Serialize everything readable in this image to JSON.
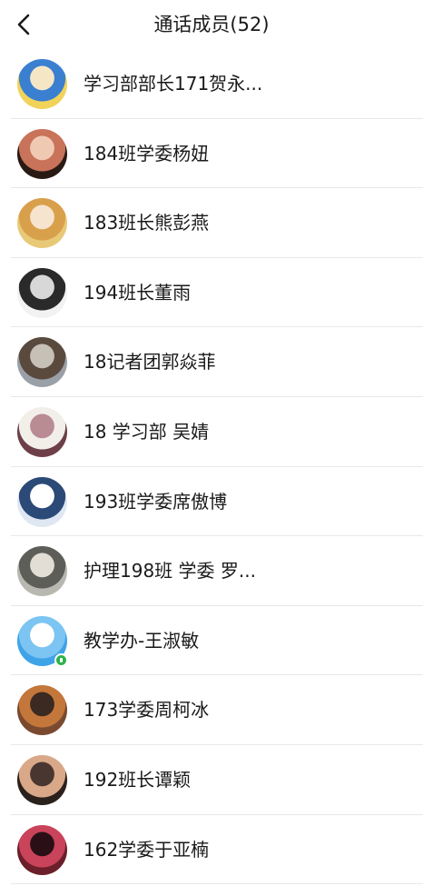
{
  "header": {
    "title": "通话成员(52)",
    "back_icon": "chevron-left-icon"
  },
  "members": [
    {
      "name": "学习部部长171贺永...",
      "avatar_colors": [
        "#f2d35a",
        "#3b7fd1",
        "#f5e7c6"
      ]
    },
    {
      "name": "184班学委杨妞",
      "avatar_colors": [
        "#2a1a14",
        "#c9735a",
        "#f0c9b2"
      ]
    },
    {
      "name": "183班长熊彭燕",
      "avatar_colors": [
        "#e8c978",
        "#d9a04c",
        "#f7e4cf"
      ]
    },
    {
      "name": "194班长董雨",
      "avatar_colors": [
        "#f2f2f2",
        "#2a2a2a",
        "#d8d8d8"
      ]
    },
    {
      "name": "18记者团郭焱菲",
      "avatar_colors": [
        "#9aa0a8",
        "#5a4a3e",
        "#c7c0b6"
      ]
    },
    {
      "name": "18 学习部 吴婧",
      "avatar_colors": [
        "#6d3f48",
        "#f2efe9",
        "#b98b93"
      ]
    },
    {
      "name": "193班学委席傲博",
      "avatar_colors": [
        "#dfe7f2",
        "#2c4a78",
        "#ffffff"
      ]
    },
    {
      "name": "护理198班 学委 罗...",
      "avatar_colors": [
        "#b8b8b0",
        "#5e5e58",
        "#e2ded6"
      ]
    },
    {
      "name": "教学办-王淑敏",
      "avatar_colors": [
        "#3fa3e8",
        "#7cc4f2",
        "#ffffff"
      ],
      "online": true
    },
    {
      "name": "173学委周柯冰",
      "avatar_colors": [
        "#7a4a30",
        "#c4773a",
        "#3a2a22"
      ]
    },
    {
      "name": "192班长谭颖",
      "avatar_colors": [
        "#2a201c",
        "#d9a888",
        "#4a3630"
      ]
    },
    {
      "name": "162学委于亚楠",
      "avatar_colors": [
        "#6b1f2a",
        "#c9435a",
        "#2a1016"
      ]
    }
  ]
}
